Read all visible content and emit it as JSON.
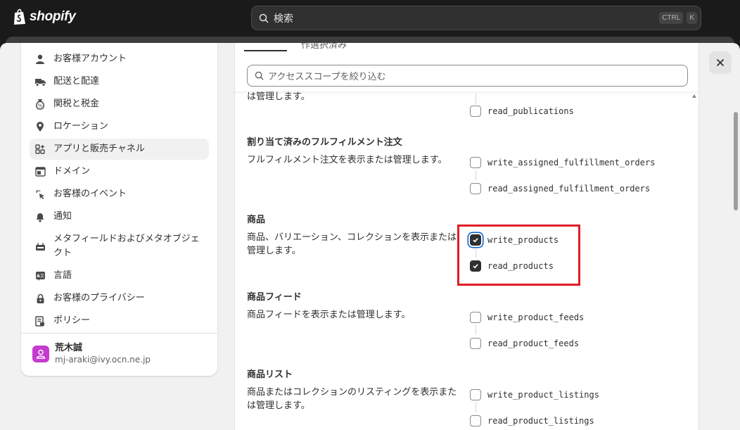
{
  "topbar": {
    "logo_text": "shopify",
    "search_placeholder": "検索",
    "shortcut_ctrl": "CTRL",
    "shortcut_k": "K"
  },
  "sidebar": {
    "items": [
      {
        "label": "お客様アカウント",
        "icon": "person-icon"
      },
      {
        "label": "配送と配達",
        "icon": "truck-icon"
      },
      {
        "label": "関税と税金",
        "icon": "tax-bag-icon"
      },
      {
        "label": "ロケーション",
        "icon": "location-pin-icon"
      },
      {
        "label": "アプリと販売チャネル",
        "icon": "apps-icon",
        "active": true
      },
      {
        "label": "ドメイン",
        "icon": "domain-icon"
      },
      {
        "label": "お客様のイベント",
        "icon": "cursor-click-icon"
      },
      {
        "label": "通知",
        "icon": "bell-icon"
      },
      {
        "label": "メタフィールドおよびメタオブジェクト",
        "icon": "metafield-icon"
      },
      {
        "label": "言語",
        "icon": "language-icon"
      },
      {
        "label": "お客様のプライバシー",
        "icon": "lock-icon"
      },
      {
        "label": "ポリシー",
        "icon": "policy-icon"
      }
    ],
    "user": {
      "name": "荒木誠",
      "email": "mj-araki@ivy.ocn.ne.jp"
    }
  },
  "main": {
    "tab_partial": "作選択済み",
    "filter_placeholder": "アクセススコープを絞り込む",
    "top_desc_partial": "は管理します。",
    "top_perm": {
      "label": "read_publications",
      "checked": false
    },
    "scopes": [
      {
        "title": "割り当て済みのフルフィルメント注文",
        "desc": "フルフィルメント注文を表示または管理します。",
        "perms": [
          {
            "label": "write_assigned_fulfillment_orders",
            "checked": false
          },
          {
            "label": "read_assigned_fulfillment_orders",
            "checked": false
          }
        ]
      },
      {
        "title": "商品",
        "desc": "商品、バリエーション、コレクションを表示または管理します。",
        "perms": [
          {
            "label": "write_products",
            "checked": true
          },
          {
            "label": "read_products",
            "checked": true
          }
        ]
      },
      {
        "title": "商品フィード",
        "desc": "商品フィードを表示または管理します。",
        "perms": [
          {
            "label": "write_product_feeds",
            "checked": false
          },
          {
            "label": "read_product_feeds",
            "checked": false
          }
        ]
      },
      {
        "title": "商品リスト",
        "desc": "商品またはコレクションのリスティングを表示または管理します。",
        "perms": [
          {
            "label": "write_product_listings",
            "checked": false
          },
          {
            "label": "read_product_listings",
            "checked": false
          }
        ]
      }
    ]
  },
  "colors": {
    "accent_highlight": "#e01e26",
    "checked": "#303030",
    "focus_ring": "#005bd3",
    "avatar": "#c73ad1"
  }
}
